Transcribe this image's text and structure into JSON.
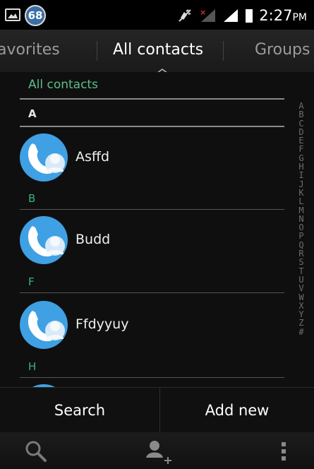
{
  "status_bar": {
    "notification_badge": "68",
    "time": "2:27",
    "ampm": "PM",
    "icons": [
      "image-icon",
      "mute-icon",
      "signal-sim1-icon",
      "signal-sim2-icon",
      "battery-icon"
    ]
  },
  "tabs": [
    {
      "label": "Favorites",
      "visible_label": "avorites"
    },
    {
      "label": "All contacts",
      "selected": true
    },
    {
      "label": "Groups"
    }
  ],
  "list": {
    "title": "All contacts",
    "sections": [
      {
        "letter": "A",
        "contacts": [
          {
            "name": "Asffd"
          }
        ]
      },
      {
        "letter": "B",
        "contacts": [
          {
            "name": "Budd"
          }
        ]
      },
      {
        "letter": "F",
        "contacts": [
          {
            "name": "Ffdyyuy"
          }
        ]
      },
      {
        "letter": "H",
        "contacts": []
      }
    ],
    "index": [
      "A",
      "B",
      "C",
      "D",
      "E",
      "F",
      "G",
      "H",
      "I",
      "J",
      "K",
      "L",
      "M",
      "N",
      "O",
      "P",
      "Q",
      "R",
      "S",
      "T",
      "U",
      "V",
      "W",
      "X",
      "Y",
      "Z",
      "#"
    ]
  },
  "actions": {
    "search_label": "Search",
    "add_label": "Add new"
  },
  "navbar": {
    "icons": [
      "search-icon",
      "add-contact-icon",
      "menu-icon"
    ]
  },
  "colors": {
    "accent_green": "#3bb37a",
    "avatar_blue": "#3fa0e3",
    "badge_blue": "#3a6ea5"
  }
}
